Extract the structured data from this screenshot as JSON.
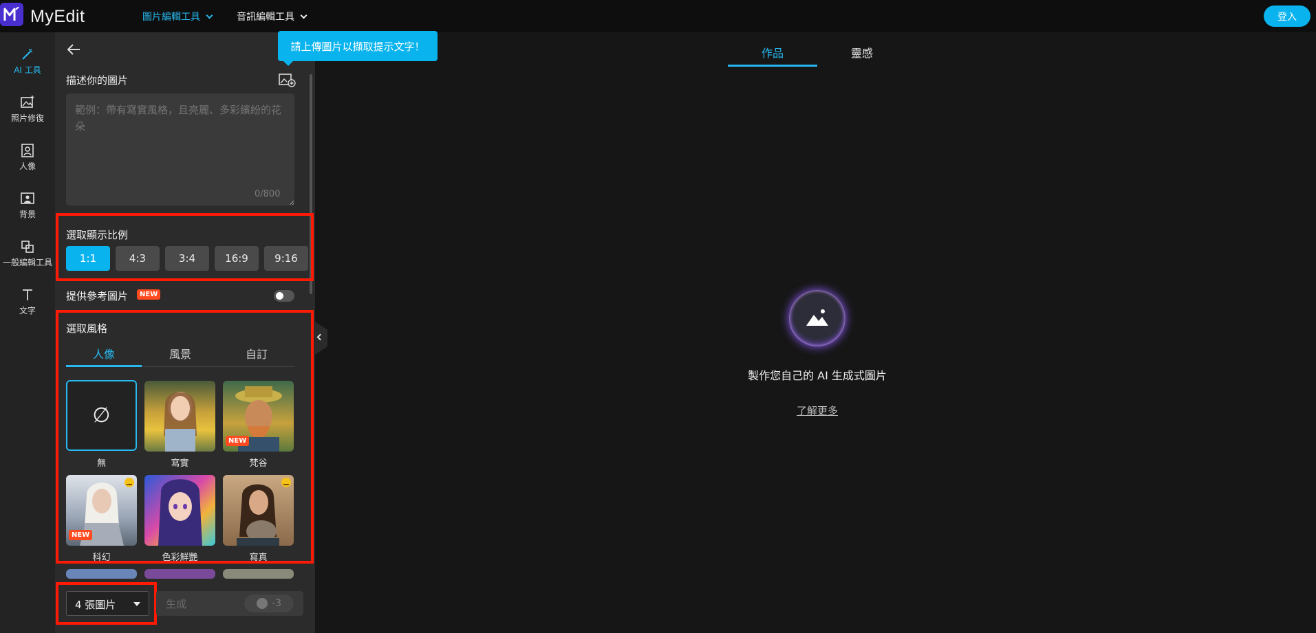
{
  "app": {
    "name": "MyEdit"
  },
  "header": {
    "nav": [
      {
        "label": "圖片編輯工具",
        "active": true
      },
      {
        "label": "音訊編輯工具",
        "active": false
      }
    ],
    "login_label": "登入"
  },
  "rail": {
    "items": [
      {
        "label": "AI 工具",
        "icon": "magic-wand-icon",
        "active": true
      },
      {
        "label": "照片修復",
        "icon": "photo-repair-icon",
        "active": false
      },
      {
        "label": "人像",
        "icon": "portrait-icon",
        "active": false
      },
      {
        "label": "背景",
        "icon": "background-icon",
        "active": false
      },
      {
        "label": "一般編輯工具",
        "icon": "edit-tools-icon",
        "active": false
      },
      {
        "label": "文字",
        "icon": "text-icon",
        "active": false
      }
    ]
  },
  "panel": {
    "tooltip": "請上傳圖片以擷取提示文字！",
    "describe_title": "描述你的圖片",
    "prompt_placeholder": "範例：帶有寫實風格，且亮麗、多彩繽紛的花朵",
    "prompt_counter": "0/800",
    "ratio_title": "選取顯示比例",
    "ratios": [
      "1:1",
      "4:3",
      "3:4",
      "16:9",
      "9:16"
    ],
    "selected_ratio": "1:1",
    "reference_label": "提供參考圖片",
    "new_badge": "NEW",
    "reference_enabled": false,
    "style_title": "選取風格",
    "style_tabs": [
      "人像",
      "風景",
      "自訂"
    ],
    "active_style_tab": "人像",
    "styles": [
      {
        "label": "無",
        "premium": false,
        "new": false
      },
      {
        "label": "寫實",
        "premium": false,
        "new": false
      },
      {
        "label": "梵谷",
        "premium": false,
        "new": true
      },
      {
        "label": "科幻",
        "premium": true,
        "new": true
      },
      {
        "label": "色彩鮮艷",
        "premium": false,
        "new": false
      },
      {
        "label": "寫真",
        "premium": true,
        "new": false
      }
    ],
    "image_count": "4 張圖片",
    "generate_label": "生成",
    "credit_cost": "-3"
  },
  "main": {
    "tabs": [
      "作品",
      "靈感"
    ],
    "active_tab": "作品",
    "empty_message": "製作您自己的 AI 生成式圖片",
    "learn_more": "了解更多"
  },
  "colors": {
    "accent": "#09b3ee",
    "highlight": "#ff1a05",
    "new_badge": "#ff4b1f"
  }
}
